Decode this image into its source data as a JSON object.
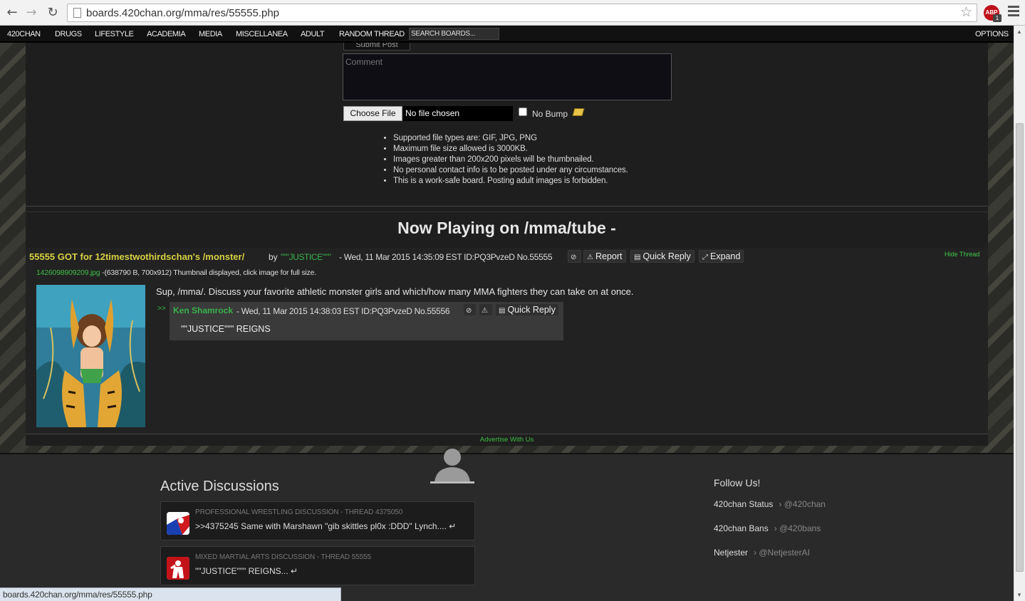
{
  "browser": {
    "url": "boards.420chan.org/mma/res/55555.php",
    "abp_label": "ABP",
    "abp_count": "1"
  },
  "sitenav": {
    "items": [
      "420CHAN",
      "DRUGS",
      "LIFESTYLE",
      "ACADEMIA",
      "MEDIA",
      "MISCELLANEA",
      "ADULT",
      "RANDOM THREAD"
    ],
    "search_placeholder": "SEARCH BOARDS...",
    "options": "OPTIONS"
  },
  "form": {
    "submit_label": "Submit Post",
    "comment_placeholder": "Comment",
    "choose_file": "Choose File",
    "file_status": "No file chosen",
    "no_bump": "No Bump",
    "rules": [
      "Supported file types are: GIF, JPG, PNG",
      "Maximum file size allowed is 3000KB.",
      "Images greater than 200x200 pixels will be thumbnailed.",
      "No personal contact info is to be posted under any circumstances.",
      "This is a work-safe board. Posting adult images is forbidden."
    ]
  },
  "now_playing": "Now Playing on /mma/tube -",
  "thread": {
    "subject": "55555 GOT for 12timestwothirdschan's /monster/",
    "by": "by",
    "name": "\"\"\"JUSTICE\"\"\"",
    "meta": "- Wed, 11 Mar 2015 14:35:09 EST ID:PQ3PvzeD No.55555",
    "report": "Report",
    "quick_reply": "Quick Reply",
    "expand": "Expand",
    "hide_thread": "Hide Thread",
    "file_name": "1426098909209.jpg",
    "file_info": " -(638790 B, 700x912) Thumbnail displayed, click image for full size.",
    "body": "Sup, /mma/. Discuss your favorite athletic monster girls and which/how many MMA fighters they can take on at once."
  },
  "reply": {
    "arrow": ">>",
    "name": "Ken Shamrock",
    "meta": "- Wed, 11 Mar 2015 14:38:03 EST ID:PQ3PvzeD No.55556",
    "quick_reply": "Quick Reply",
    "body": "\"\"JUSTICE\"\"\" REIGNS"
  },
  "advertise": "Advertise With Us",
  "footer": {
    "active_title": "Active Discussions",
    "discussions": [
      {
        "board": "PROFESSIONAL WRESTLING DISCUSSION",
        "thread": "- THREAD 4375050",
        "text": ">>4375245 Same with Marshawn \"gib skittles pl0x :DDD\" Lynch.... ↵"
      },
      {
        "board": "MIXED MARTIAL ARTS DISCUSSION",
        "thread": "- THREAD 55555",
        "text": "\"\"JUSTICE\"\"\" REIGNS... ↵"
      }
    ],
    "follow_title": "Follow Us!",
    "follow": [
      {
        "name": "420chan Status",
        "handle": "› @420chan"
      },
      {
        "name": "420chan Bans",
        "handle": "› @420bans"
      },
      {
        "name": "Netjester",
        "handle": "› @NetjesterAI"
      }
    ]
  },
  "statusbar": "boards.420chan.org/mma/res/55555.php"
}
